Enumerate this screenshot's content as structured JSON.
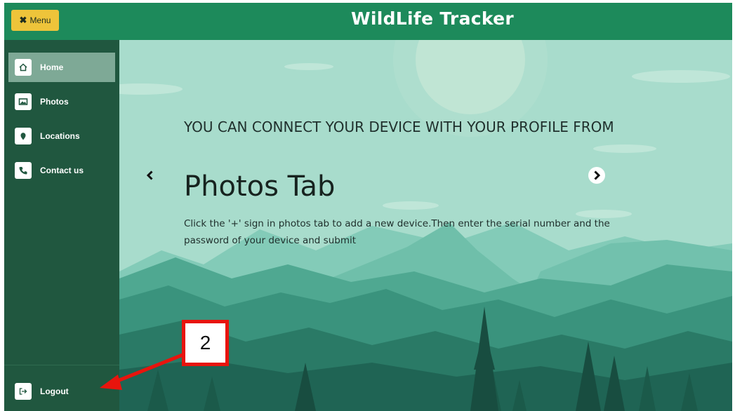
{
  "header": {
    "menu_label": "Menu",
    "menu_icon": "close-icon",
    "title": "WildLife Tracker",
    "accent_color": "#1d8a5b",
    "menu_button_color": "#eec43a"
  },
  "sidebar": {
    "items": [
      {
        "label": "Home",
        "icon": "home-icon",
        "active": true
      },
      {
        "label": "Photos",
        "icon": "image-icon",
        "active": false
      },
      {
        "label": "Locations",
        "icon": "map-pin-icon",
        "active": false
      },
      {
        "label": "Contact us",
        "icon": "phone-icon",
        "active": false
      }
    ],
    "logout_label": "Logout",
    "logout_icon": "logout-icon",
    "background_color": "#20573f"
  },
  "slide": {
    "heading": "YOU CAN CONNECT YOUR DEVICE WITH YOUR PROFILE FROM",
    "title": "Photos Tab",
    "description": "Click the '+' sign in photos tab to add a new device.Then enter the serial number and the password of your device and submit",
    "prev_icon": "chevron-left-icon",
    "next_icon": "chevron-right-icon"
  },
  "annotation": {
    "label": "2",
    "color": "#e8140d"
  }
}
